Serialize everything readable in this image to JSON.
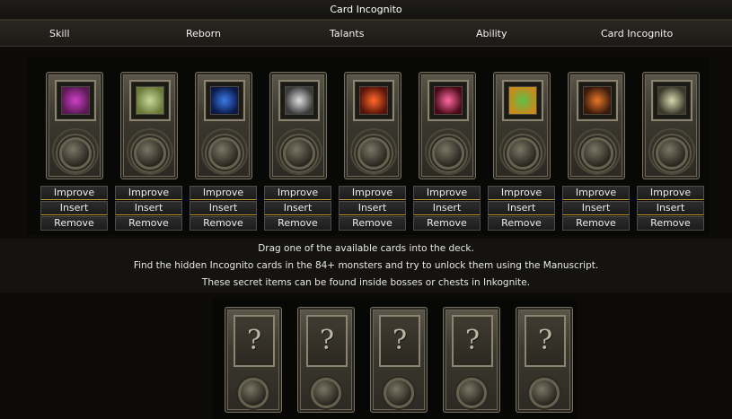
{
  "window": {
    "title": "Card Incognito"
  },
  "nav": {
    "tabs": [
      {
        "label": "Skill"
      },
      {
        "label": "Reborn"
      },
      {
        "label": "Talants"
      },
      {
        "label": "Ability"
      },
      {
        "label": "Card Incognito"
      }
    ]
  },
  "deck": {
    "buttons": {
      "improve": "Improve",
      "insert": "Insert",
      "remove": "Remove"
    },
    "cards": [
      {
        "icon": "eye-triangle-icon",
        "colors": [
          "#d040c8",
          "#5a1a55"
        ]
      },
      {
        "icon": "tree-icon",
        "colors": [
          "#c8d89a",
          "#6a7a3a"
        ]
      },
      {
        "icon": "crossed-swords-icon",
        "colors": [
          "#3a7ae8",
          "#0b1a4a"
        ]
      },
      {
        "icon": "claw-icon",
        "colors": [
          "#e0e0e0",
          "#3a3a3a"
        ]
      },
      {
        "icon": "fire-beast-icon",
        "colors": [
          "#ff6a2a",
          "#5a1408"
        ]
      },
      {
        "icon": "gem-icon",
        "colors": [
          "#ff6aa0",
          "#4a0a1a"
        ]
      },
      {
        "icon": "clover-icon",
        "colors": [
          "#5cc04a",
          "#c88a1a"
        ]
      },
      {
        "icon": "flame-shield-icon",
        "colors": [
          "#e8782a",
          "#3a1a0a"
        ]
      },
      {
        "icon": "skull-icon",
        "colors": [
          "#d8d8b0",
          "#3a3a2a"
        ]
      }
    ]
  },
  "info": {
    "lines": [
      "Drag one of the available cards into the deck.",
      "Find the hidden Incognito cards in the 84+ monsters and try to unlock them using the Manuscript.",
      "These secret items can be found inside bosses or chests in Inkognite."
    ]
  },
  "hidden": {
    "cards": [
      {
        "glyph": "?"
      },
      {
        "glyph": "?"
      },
      {
        "glyph": "?"
      },
      {
        "glyph": "?"
      },
      {
        "glyph": "?"
      }
    ]
  }
}
